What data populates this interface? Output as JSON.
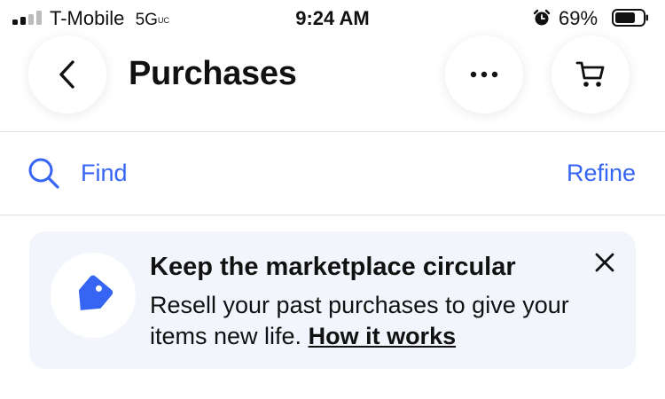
{
  "status_bar": {
    "carrier": "T-Mobile",
    "network": "5G",
    "network_suffix": "UC",
    "time": "9:24 AM",
    "battery_percent": "69%",
    "icons": [
      "signal-icon",
      "alarm-icon",
      "battery-icon"
    ]
  },
  "header": {
    "title": "Purchases",
    "back_icon": "chevron-left-icon",
    "more_icon": "more-horizontal-icon",
    "cart_icon": "cart-icon"
  },
  "search_row": {
    "find_label": "Find",
    "refine_label": "Refine",
    "search_icon": "search-icon"
  },
  "banner": {
    "title": "Keep the marketplace circular",
    "body": "Resell your past purchases to give your items new life.",
    "link_label": "How it works",
    "icon": "price-tag-icon",
    "close_icon": "close-icon"
  },
  "colors": {
    "accent": "#3665f3",
    "banner_bg": "#f2f5fc",
    "text": "#111111"
  }
}
